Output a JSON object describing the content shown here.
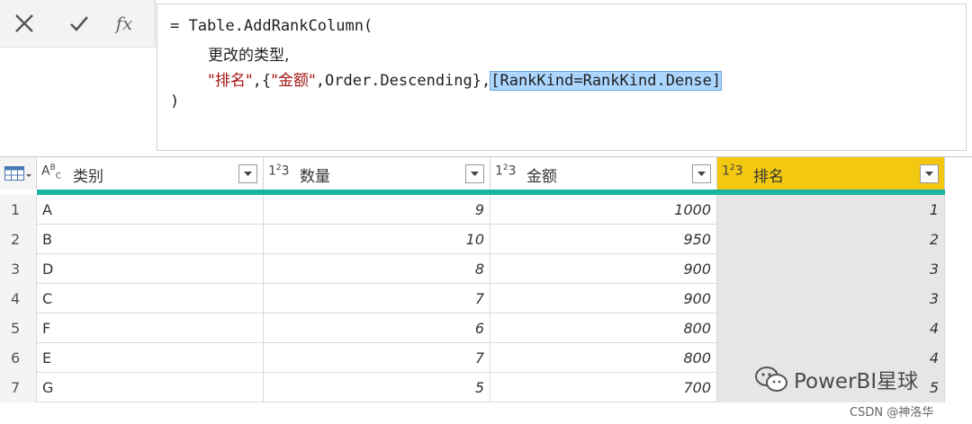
{
  "formula": {
    "line1": "= Table.AddRankColumn(",
    "line2": "更改的类型,",
    "line3_str1": "\"排名\"",
    "line3_sep1": ",{",
    "line3_str2": "\"金额\"",
    "line3_rest": ",Order.Descending},",
    "line3_highlight": "[RankKind=RankKind.Dense]",
    "line4": ")"
  },
  "toolbar": {
    "fx_label": "fx"
  },
  "columns": [
    {
      "type": "ABC",
      "name": "类别"
    },
    {
      "type": "123",
      "name": "数量"
    },
    {
      "type": "123",
      "name": "金额"
    },
    {
      "type": "123",
      "name": "排名"
    }
  ],
  "rows": [
    {
      "n": "1",
      "cat": "A",
      "qty": "9",
      "amt": "1000",
      "rank": "1"
    },
    {
      "n": "2",
      "cat": "B",
      "qty": "10",
      "amt": "950",
      "rank": "2"
    },
    {
      "n": "3",
      "cat": "D",
      "qty": "8",
      "amt": "900",
      "rank": "3"
    },
    {
      "n": "4",
      "cat": "C",
      "qty": "7",
      "amt": "900",
      "rank": "3"
    },
    {
      "n": "5",
      "cat": "F",
      "qty": "6",
      "amt": "800",
      "rank": "4"
    },
    {
      "n": "6",
      "cat": "E",
      "qty": "7",
      "amt": "800",
      "rank": "4"
    },
    {
      "n": "7",
      "cat": "G",
      "qty": "5",
      "amt": "700",
      "rank": "5"
    }
  ],
  "watermark": {
    "text": "PowerBI星球",
    "credit": "CSDN @神洛华"
  },
  "colors": {
    "selected_header": "#f2c811",
    "quality_bar": "#19b4a2",
    "highlight": "#add6ff"
  }
}
